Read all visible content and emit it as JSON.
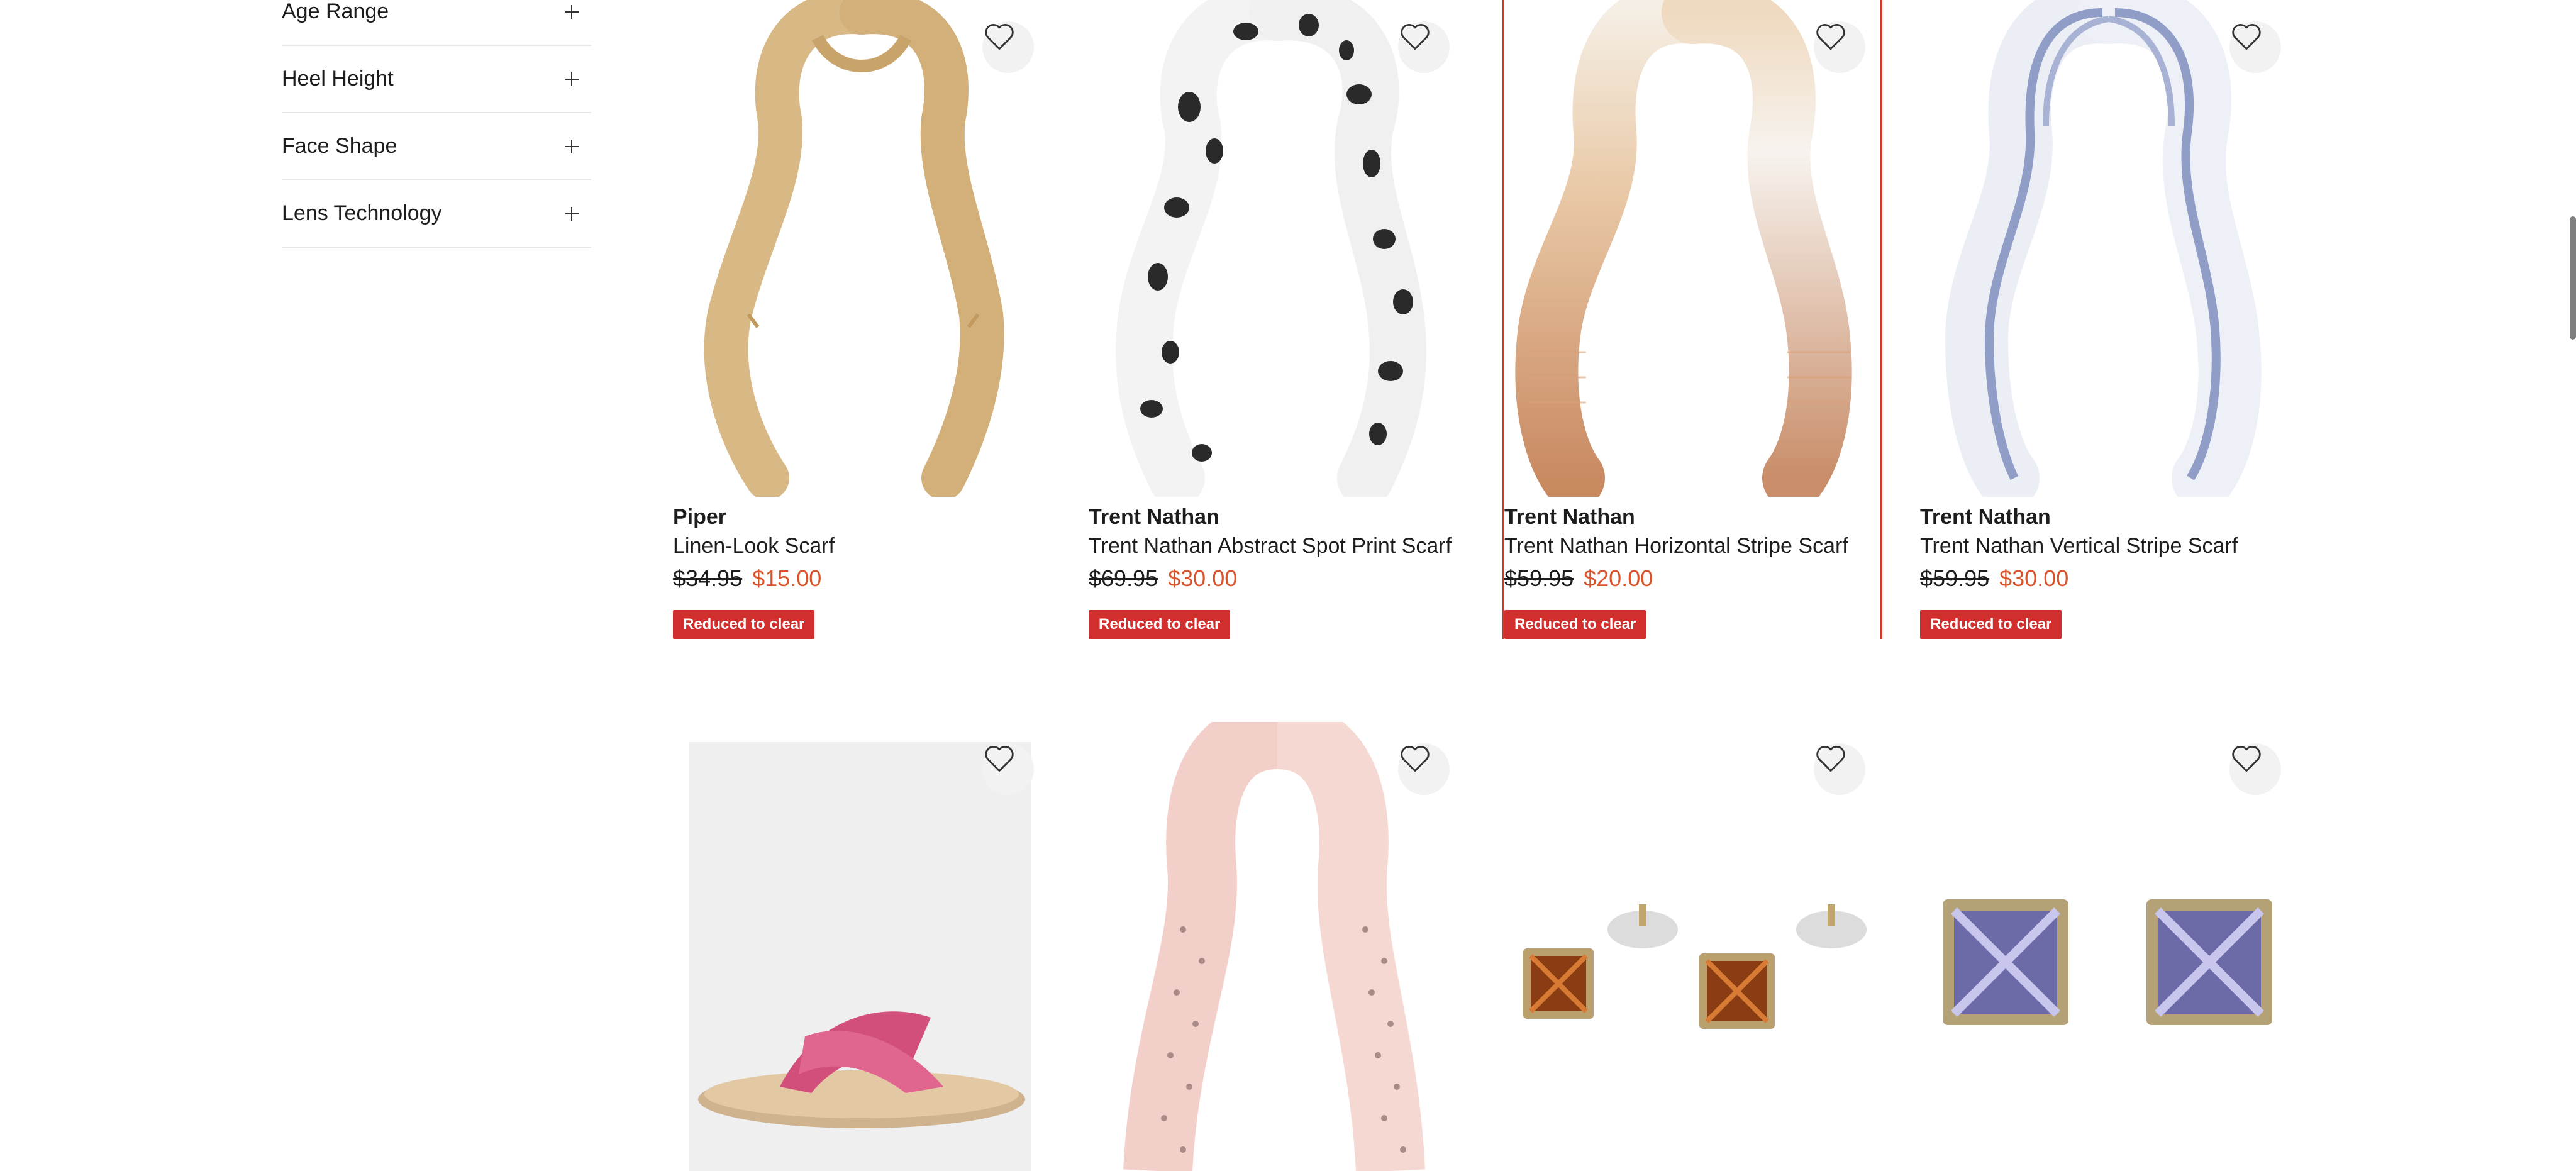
{
  "filters": [
    {
      "label": "Age Range"
    },
    {
      "label": "Heel Height"
    },
    {
      "label": "Face Shape"
    },
    {
      "label": "Lens Technology"
    }
  ],
  "products": [
    {
      "brand": "Piper",
      "name": "Linen-Look Scarf",
      "price_was": "$34.95",
      "price_now": "$15.00",
      "badge": "Reduced to clear",
      "image": "beige-scarf"
    },
    {
      "brand": "Trent Nathan",
      "name": "Trent Nathan Abstract Spot Print Scarf",
      "price_was": "$69.95",
      "price_now": "$30.00",
      "badge": "Reduced to clear",
      "image": "spot-print-scarf"
    },
    {
      "brand": "Trent Nathan",
      "name": "Trent Nathan Horizontal Stripe Scarf",
      "price_was": "$59.95",
      "price_now": "$20.00",
      "badge": "Reduced to clear",
      "image": "horizontal-stripe-scarf",
      "highlighted": true
    },
    {
      "brand": "Trent Nathan",
      "name": "Trent Nathan Vertical Stripe Scarf",
      "price_was": "$59.95",
      "price_now": "$30.00",
      "badge": "Reduced to clear",
      "image": "vertical-stripe-scarf"
    },
    {
      "image": "pink-slide-sandal"
    },
    {
      "image": "pink-dot-scarf"
    },
    {
      "image": "amber-stud-earrings"
    },
    {
      "image": "purple-stud-earrings"
    }
  ],
  "colors": {
    "sale_price": "#d9542b",
    "badge_bg": "#d12e2e",
    "highlight_border": "#d9362b"
  }
}
